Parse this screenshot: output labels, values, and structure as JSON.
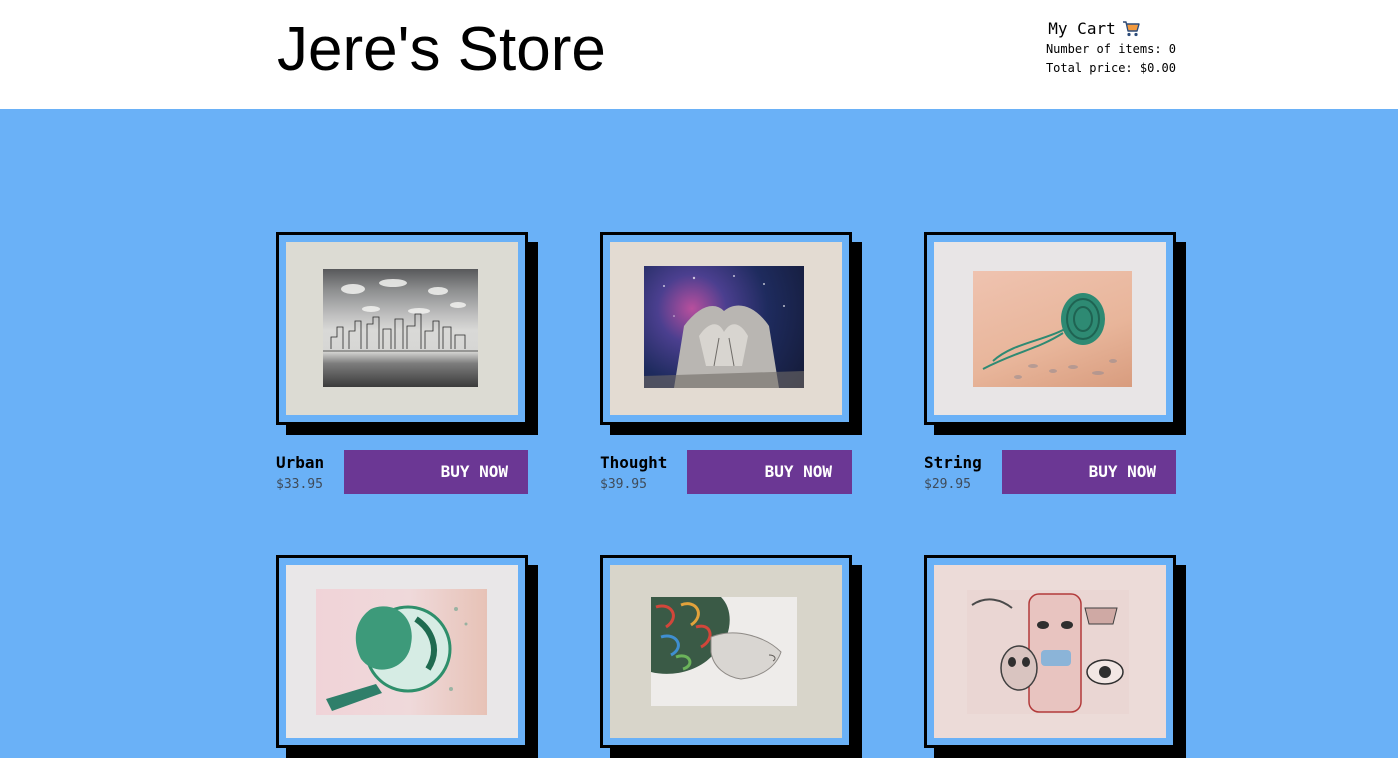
{
  "header": {
    "title": "Jere's Store"
  },
  "cart": {
    "title": "My Cart",
    "icon": "cart-icon",
    "items_line": "Number of items: 0",
    "total_line": "Total price: $0.00"
  },
  "colors": {
    "background": "#6ab1f7",
    "button": "#6b3794",
    "header": "#ffffff"
  },
  "products": [
    {
      "name": "Urban",
      "price": "$33.95",
      "button": "BUY NOW"
    },
    {
      "name": "Thought",
      "price": "$39.95",
      "button": "BUY NOW"
    },
    {
      "name": "String",
      "price": "$29.95",
      "button": "BUY NOW"
    },
    {
      "name": "",
      "price": "",
      "button": ""
    },
    {
      "name": "",
      "price": "",
      "button": ""
    },
    {
      "name": "",
      "price": "",
      "button": ""
    }
  ]
}
